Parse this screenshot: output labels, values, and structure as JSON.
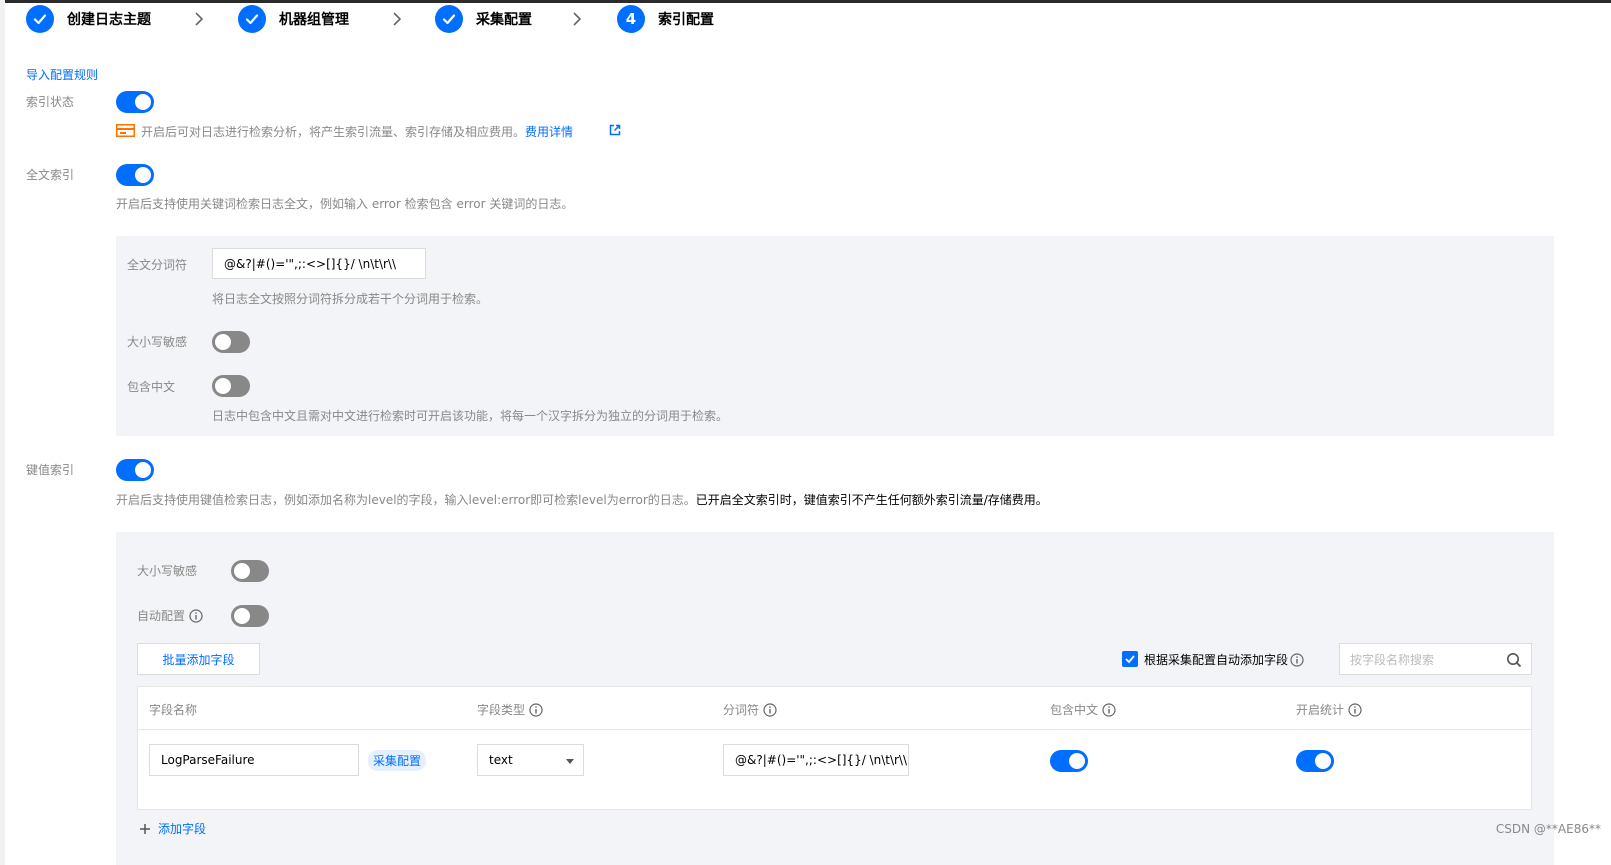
{
  "steps": [
    {
      "label": "创建日志主题",
      "state": "done"
    },
    {
      "label": "机器组管理",
      "state": "done"
    },
    {
      "label": "采集配置",
      "state": "done"
    },
    {
      "label": "索引配置",
      "state": "active",
      "number": "4"
    }
  ],
  "import_rule_link": "导入配置规则",
  "index_status": {
    "label": "索引状态",
    "enabled": true,
    "notice": "开启后可对日志进行检索分析，将产生索引流量、索引存储及相应费用。",
    "notice_link": "费用详情"
  },
  "full_text_index": {
    "label": "全文索引",
    "enabled": true,
    "hint": "开启后支持使用关键词检索日志全文，例如输入 error 检索包含 error 关键词的日志。",
    "delimiter_label": "全文分词符",
    "delimiter_value": "@&?|#()='\",;:<>[]{}/ \\n\\t\\r\\\\",
    "delimiter_hint": "将日志全文按照分词符拆分成若干个分词用于检索。",
    "case_sensitive_label": "大小写敏感",
    "case_sensitive": false,
    "chinese_label": "包含中文",
    "chinese": false,
    "chinese_hint": "日志中包含中文且需对中文进行检索时可开启该功能，将每一个汉字拆分为独立的分词用于检索。"
  },
  "kv_index": {
    "label": "键值索引",
    "enabled": true,
    "hint": "开启后支持使用键值检索日志，例如添加名称为level的字段，输入level:error即可检索level为error的日志。",
    "hint_strong": "已开启全文索引时，键值索引不产生任何额外索引流量/存储费用。",
    "case_sensitive_label": "大小写敏感",
    "case_sensitive": false,
    "auto_config_label": "自动配置",
    "auto_config": false,
    "batch_add_button": "批量添加字段",
    "auto_add_checkbox_label": "根据采集配置自动添加字段",
    "auto_add_checked": true,
    "search_placeholder": "按字段名称搜索",
    "columns": [
      "字段名称",
      "字段类型",
      "分词符",
      "包含中文",
      "开启统计"
    ],
    "rows": [
      {
        "field_name": "LogParseFailure",
        "source_tag": "采集配置",
        "field_type": "text",
        "delimiter": "@&?|#()='\",;:<>[]{}/ \\n\\t\\r\\\\",
        "chinese": true,
        "statistics": true
      }
    ],
    "add_field_link": "添加字段"
  },
  "watermark": "CSDN @**AE86**",
  "colors": {
    "accent": "#006eff",
    "panel": "#f3f4f7",
    "warning": "#ff7200"
  }
}
